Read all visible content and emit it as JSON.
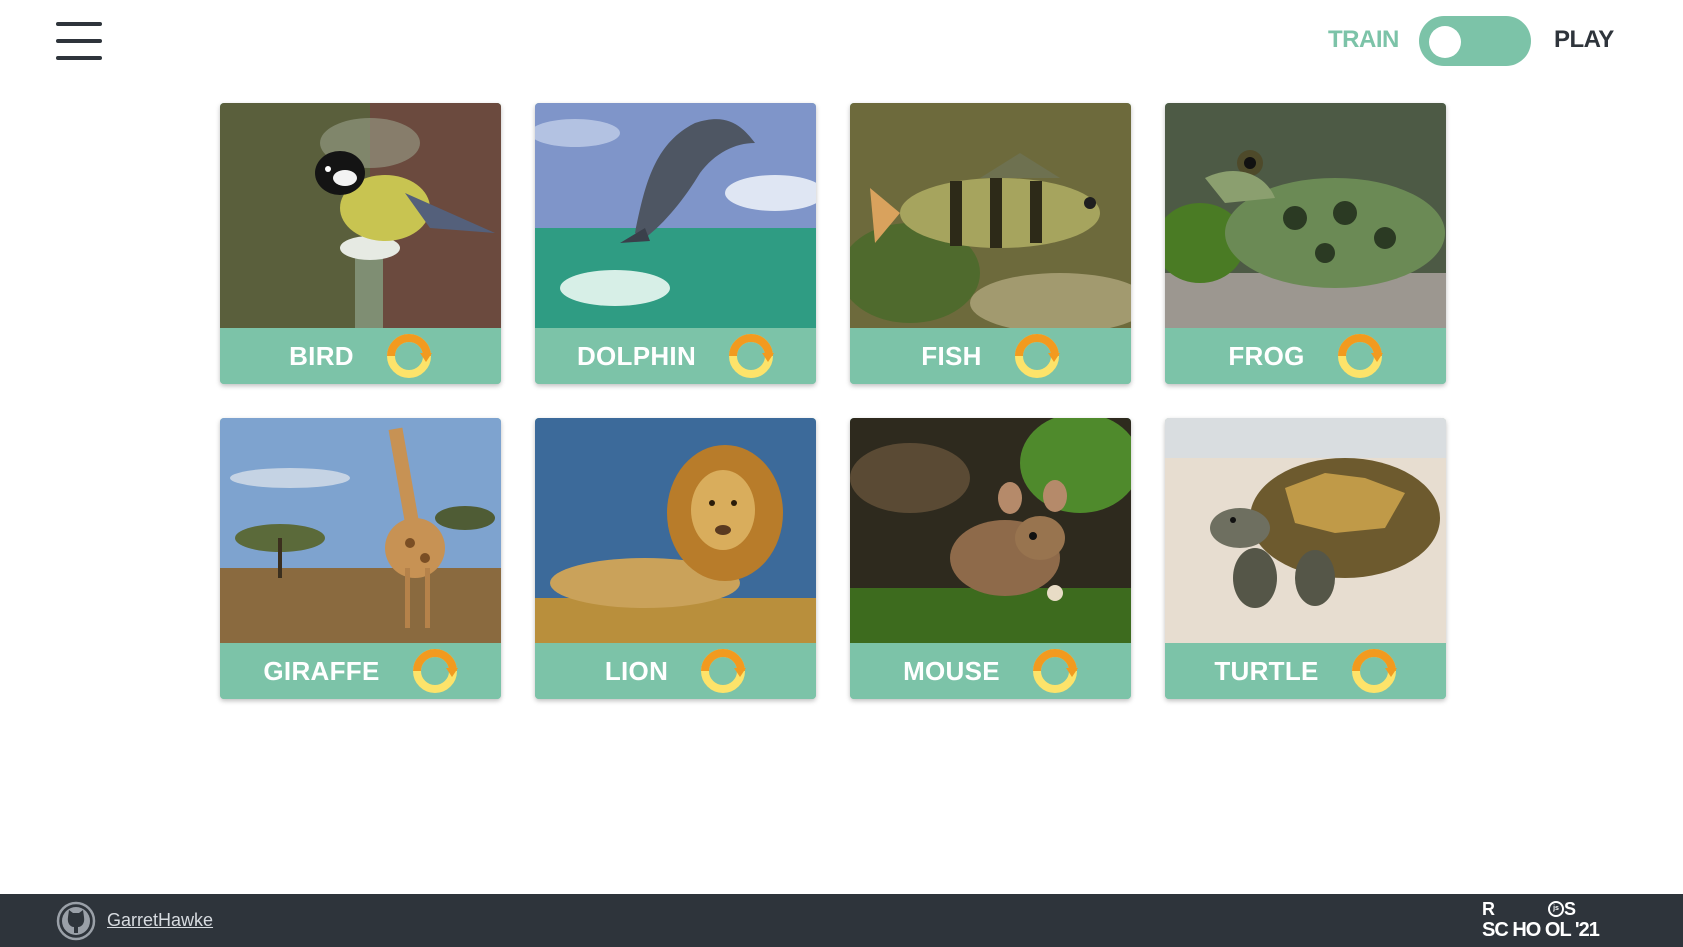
{
  "header": {
    "menu_icon": "hamburger-menu-icon",
    "mode_left_label": "TRAIN",
    "mode_right_label": "PLAY",
    "toggle_state": "train"
  },
  "cards": [
    {
      "word": "BIRD",
      "image": "bird-photo",
      "rotate_icon": "rotate-icon"
    },
    {
      "word": "DOLPHIN",
      "image": "dolphin-photo",
      "rotate_icon": "rotate-icon"
    },
    {
      "word": "FISH",
      "image": "fish-photo",
      "rotate_icon": "rotate-icon"
    },
    {
      "word": "FROG",
      "image": "frog-photo",
      "rotate_icon": "rotate-icon"
    },
    {
      "word": "GIRAFFE",
      "image": "giraffe-photo",
      "rotate_icon": "rotate-icon"
    },
    {
      "word": "LION",
      "image": "lion-photo",
      "rotate_icon": "rotate-icon"
    },
    {
      "word": "MOUSE",
      "image": "mouse-photo",
      "rotate_icon": "rotate-icon"
    },
    {
      "word": "TURTLE",
      "image": "turtle-photo",
      "rotate_icon": "rotate-icon"
    }
  ],
  "footer": {
    "github_icon": "github-icon",
    "author_link": "GarretHawke",
    "school_logo_line1": "R S",
    "school_logo_line2": "SC HO OL '21"
  },
  "colors": {
    "accent": "#7cc3a8",
    "dark": "#2e343b",
    "rotate_orange": "#f29a1f",
    "rotate_yellow": "#fde36a"
  }
}
